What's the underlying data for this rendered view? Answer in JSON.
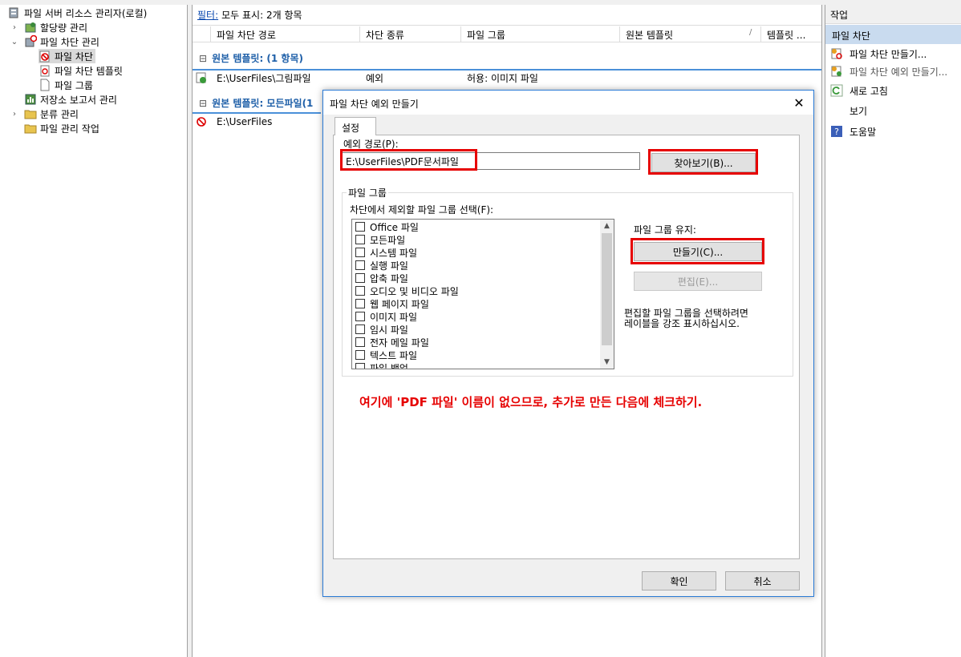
{
  "tree": {
    "items": [
      {
        "label": "파일 서버 리소스 관리자(로컬)",
        "icon": "server-icon"
      },
      {
        "label": "할당량 관리",
        "icon": "quota-icon"
      },
      {
        "label": "파일 차단 관리",
        "icon": "file-screen-icon"
      },
      {
        "label": "파일 차단",
        "icon": "file-screen-block-icon"
      },
      {
        "label": "파일 차단 템플릿",
        "icon": "template-icon"
      },
      {
        "label": "파일 그룹",
        "icon": "file-icon"
      },
      {
        "label": "저장소 보고서 관리",
        "icon": "report-icon"
      },
      {
        "label": "분류 관리",
        "icon": "folder-icon"
      },
      {
        "label": "파일 관리 작업",
        "icon": "folder-icon"
      }
    ]
  },
  "list": {
    "filter_link": "필터:",
    "filter_text": "모두 표시: 2개 항목",
    "columns": [
      "파일 차단 경로",
      "차단 종류",
      "파일 그룹",
      "원본 템플릿",
      "템플릿 ..."
    ],
    "group1": "원본 템플릿: (1 항목)",
    "row1": {
      "path": "E:\\UserFiles\\그림파일",
      "type": "예외",
      "group": "허용: 이미지 파일"
    },
    "group2": "원본 템플릿: 모든파일(1",
    "row2": {
      "path": "E:\\UserFiles"
    }
  },
  "actions": {
    "header": "작업",
    "section": "파일 차단",
    "items": [
      {
        "label": "파일 차단 만들기...",
        "icon": "create-screen-icon"
      },
      {
        "label": "파일 차단 예외 만들기...",
        "icon": "create-exception-icon"
      },
      {
        "label": "새로 고침",
        "icon": "refresh-icon"
      },
      {
        "label": "보기",
        "icon": ""
      },
      {
        "label": "도움말",
        "icon": "help-icon"
      }
    ]
  },
  "dialog": {
    "title": "파일 차단 예외 만들기",
    "tab": "설정",
    "path_label": "예외 경로(P):",
    "path_value": "E:\\UserFiles\\PDF문서파일",
    "browse_button": "찾아보기(B)...",
    "group_title": "파일 그룹",
    "select_label": "차단에서 제외할 파일 그룹 선택(F):",
    "file_groups": [
      "Office 파일",
      "모든파일",
      "시스템 파일",
      "실행 파일",
      "압축 파일",
      "오디오 및 비디오 파일",
      "웹 페이지 파일",
      "이미지 파일",
      "임시 파일",
      "전자 메일 파일",
      "텍스트 파일",
      "파일 백업"
    ],
    "maintain_label": "파일 그룹 유지:",
    "create_button": "만들기(C)...",
    "edit_button": "편집(E)...",
    "hint_line1": "편집할 파일 그룹을 선택하려면",
    "hint_line2": "레이블을 강조 표시하십시오.",
    "annotation": "여기에 'PDF 파일' 이름이 없으므로, 추가로 만든 다음에 체크하기.",
    "ok_button": "확인",
    "cancel_button": "취소"
  },
  "colors": {
    "highlight": "#e60000",
    "accent": "#2b7bd6",
    "group_text": "#1e5fa8"
  }
}
